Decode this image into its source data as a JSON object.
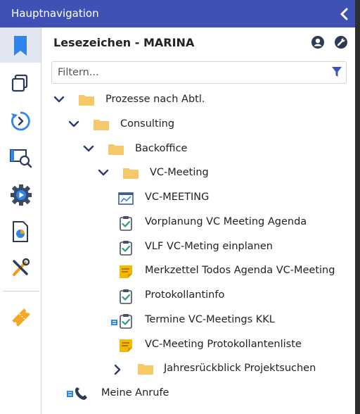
{
  "titlebar": {
    "title": "Hauptnavigation"
  },
  "panel": {
    "title": "Lesezeichen - MARINA",
    "filter_placeholder": "Filtern..."
  },
  "tree": {
    "prozesse": "Prozesse nach Abtl.",
    "consulting": "Consulting",
    "backoffice": "Backoffice",
    "vcmeeting_folder": "VC-Meeting",
    "items": [
      "VC-MEETING",
      "Vorplanung VC Meeting Agenda",
      "VLF VC-Meting einplanen",
      "Merkzettel Todos Agenda VC-Meeting",
      "Protokollantinfo",
      "Termine VC-Meetings KKL",
      "VC-Meeting Protokollantenliste"
    ],
    "jahresrueckblick": "Jahresrückblick Projektsuchen",
    "meine_anrufe": "Meine Anrufe"
  },
  "colors": {
    "accent": "#3f51b5",
    "folder": "#f5c969",
    "note": "#f5b800",
    "check": "#2e9e6e",
    "rail_active": "#e2e6f0"
  }
}
